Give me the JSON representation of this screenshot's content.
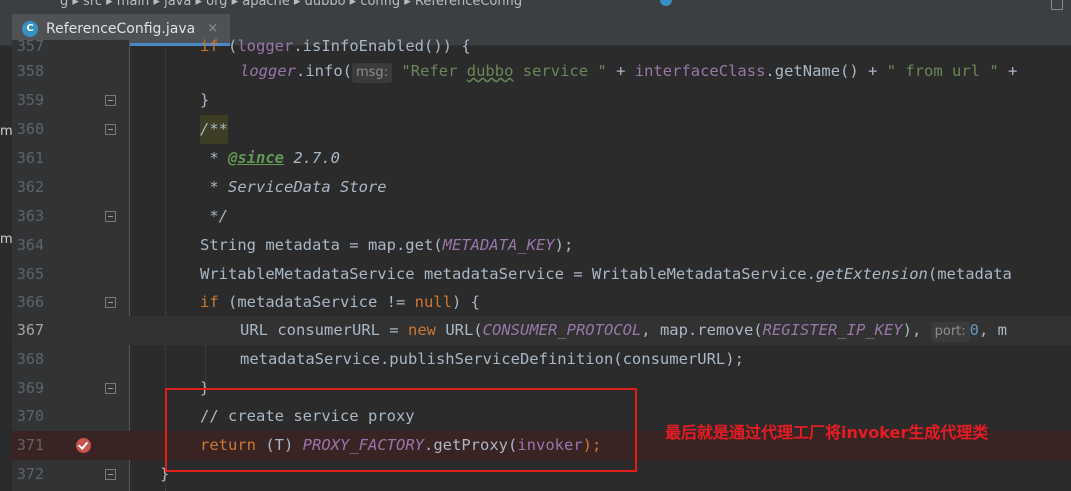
{
  "topbar": {
    "breadcrumb": "g ▸ src ▸ main ▸ java ▸ org ▸ apache ▸ dubbo ▸ config ▸ ReferenceConfig"
  },
  "tab": {
    "icon_letter": "C",
    "filename": "ReferenceConfig.java",
    "close": "×"
  },
  "left_cut": [
    "m",
    "m"
  ],
  "lines": [
    {
      "n": "357",
      "t": ""
    },
    {
      "n": "358",
      "t": ""
    },
    {
      "n": "359",
      "t": "}"
    },
    {
      "n": "360",
      "t": "/**"
    },
    {
      "n": "361",
      "t": " * @since 2.7.0"
    },
    {
      "n": "362",
      "t": " * ServiceData Store"
    },
    {
      "n": "363",
      "t": " */"
    },
    {
      "n": "364",
      "t": ""
    },
    {
      "n": "365",
      "t": ""
    },
    {
      "n": "366",
      "t": ""
    },
    {
      "n": "367",
      "t": ""
    },
    {
      "n": "368",
      "t": ""
    },
    {
      "n": "369",
      "t": "}"
    },
    {
      "n": "370",
      "t": "// create service proxy"
    },
    {
      "n": "371",
      "t": ""
    },
    {
      "n": "372",
      "t": "}"
    }
  ],
  "code": {
    "l357": "if (logger.isInfoEnabled()) {",
    "l358_a": "logger",
    "l358_b": ".info(",
    "l358_hint": "msg:",
    "l358_str1": "\"Refer ",
    "l358_str_w": "dubbo",
    "l358_str2": " service \"",
    "l358_c": " + ",
    "l358_d": "interfaceClass",
    "l358_e": ".getName() + ",
    "l358_str3": "\" from url \"",
    "l358_f": " + ",
    "l361_tag": "@since",
    "l361_rest": " 2.7.0",
    "l361_star": " * ",
    "l364_a": "String metadata = map.get(",
    "l364_b": "METADATA_KEY",
    "l364_c": ");",
    "l365_a": "WritableMetadataService metadataService = WritableMetadataService.",
    "l365_b": "getExtension",
    "l365_c": "(metadata",
    "l366_a": "if",
    "l366_b": " (metadataService != ",
    "l366_c": "null",
    "l366_d": ") {",
    "l367_a": "URL consumerURL = ",
    "l367_b": "new",
    "l367_c": " URL(",
    "l367_d": "CONSUMER_PROTOCOL",
    "l367_e": ", map.remove(",
    "l367_f": "REGISTER_IP_KEY",
    "l367_g": "),",
    "l367_hint": "port:",
    "l367_h": "0",
    "l367_i": ", m",
    "l368": "metadataService.publishServiceDefinition(consumerURL);",
    "l371_a": "return",
    "l371_b": " (T) ",
    "l371_c": "PROXY_FACTORY",
    "l371_d": ".getProxy(",
    "l371_e": "invoker",
    "l371_f": ");"
  },
  "annotation": "最后就是通过代理工厂将invoker生成代理类",
  "colors": {
    "annotation": "#e51c23",
    "box": "#e11e1e",
    "background": "#2b2b2b"
  }
}
